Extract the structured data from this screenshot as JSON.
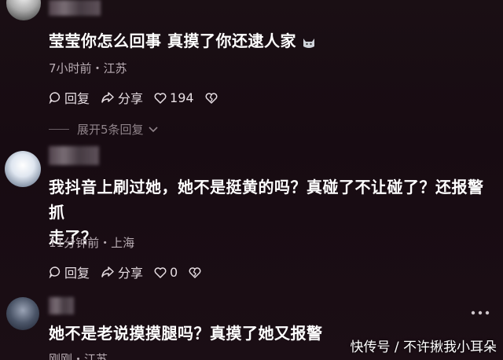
{
  "comments": [
    {
      "text": "莹莹你怎么回事 真摸了你还逮人家",
      "meta": "7小时前・江苏",
      "reply_label": "回复",
      "share_label": "分享",
      "like_count": "194",
      "expand_label": "展开5条回复"
    },
    {
      "text_line1": "我抖音上刷过她，她不是挺黄的吗？真碰了不让碰了？还报警抓",
      "text_line2": "走了？",
      "meta": "11分钟前・上海",
      "reply_label": "回复",
      "share_label": "分享",
      "like_count": "0"
    },
    {
      "text": "她不是老说摸摸腿吗？真摸了她又报警",
      "meta": "刚刚・江苏"
    }
  ],
  "watermark": "快传号 / 不许揪我小耳朵",
  "icons": [
    "reply-icon",
    "share-icon",
    "heart-icon",
    "broken-heart-icon",
    "more-options-icon"
  ]
}
